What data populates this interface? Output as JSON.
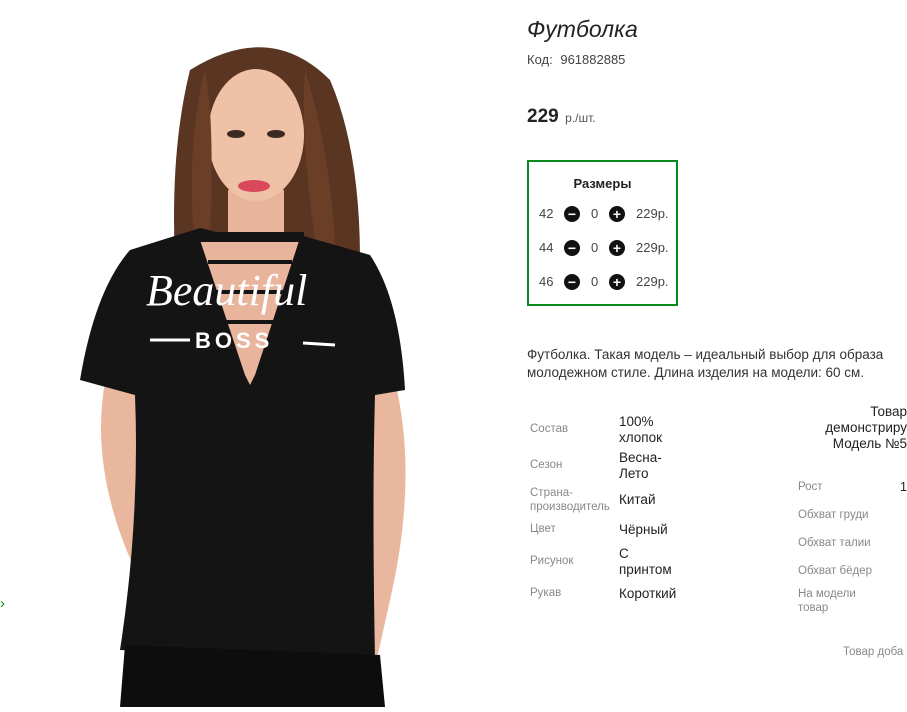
{
  "product": {
    "title": "Футболка",
    "code_label": "Код:",
    "code_value": "961882885",
    "price": "229",
    "price_unit": "р./шт."
  },
  "image": {
    "print_line1": "Beautiful",
    "print_line2": "BOSS"
  },
  "sizes": {
    "heading": "Размеры",
    "rows": [
      {
        "size": "42",
        "qty": "0",
        "price": "229р."
      },
      {
        "size": "44",
        "qty": "0",
        "price": "229р."
      },
      {
        "size": "46",
        "qty": "0",
        "price": "229р."
      }
    ]
  },
  "description": {
    "line1": "Футболка. Такая модель – идеальный выбор для образа",
    "line2": "молодежном стиле. Длина изделия на модели: 60 см."
  },
  "properties": [
    {
      "key": "Состав",
      "value": "100% хлопок"
    },
    {
      "key": "Сезон",
      "value": "Весна-Лето"
    },
    {
      "key": "Страна-производитель",
      "value": "Китай"
    },
    {
      "key": "Цвет",
      "value": "Чёрный"
    },
    {
      "key": "Рисунок",
      "value": "С принтом"
    },
    {
      "key": "Рукав",
      "value": "Короткий"
    }
  ],
  "model": {
    "note_line1": "Товар",
    "note_line2": "демонстриру",
    "note_line3": "Модель №5",
    "height_label": "Рост",
    "height_value": "1",
    "chest_label": "Обхват груди",
    "waist_label": "Обхват талии",
    "hips_label": "Обхват бёдер",
    "size_label_line1": "На модели",
    "size_label_line2": "товар"
  },
  "footer_note": "Товар доба",
  "colors": {
    "accent_green": "#0b8a1c",
    "tshirt": "#141414"
  }
}
